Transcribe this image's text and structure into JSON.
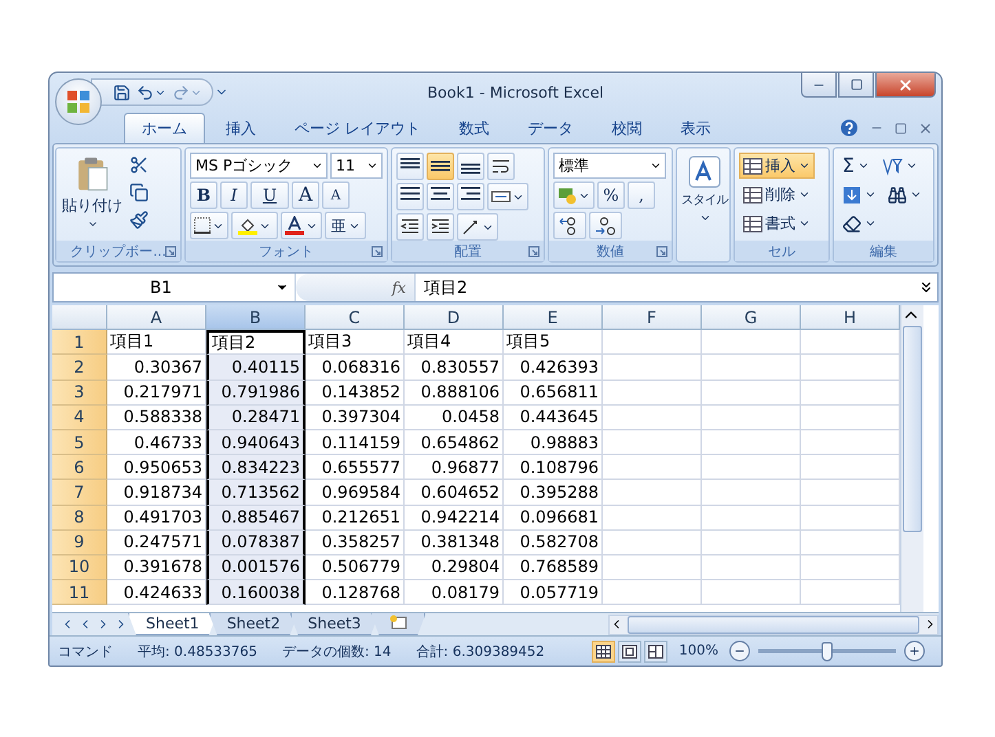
{
  "window": {
    "title": "Book1 - Microsoft Excel"
  },
  "tabs": [
    {
      "label": "ホーム",
      "selected": true
    },
    {
      "label": "挿入",
      "selected": false
    },
    {
      "label": "ページ レイアウト",
      "selected": false
    },
    {
      "label": "数式",
      "selected": false
    },
    {
      "label": "データ",
      "selected": false
    },
    {
      "label": "校閲",
      "selected": false
    },
    {
      "label": "表示",
      "selected": false
    }
  ],
  "ribbon": {
    "clipboard": {
      "label": "クリップボー...",
      "paste": "貼り付け"
    },
    "font": {
      "label": "フォント",
      "name": "MS Pゴシック",
      "size": "11",
      "bold": "B",
      "italic": "I",
      "underline": "U",
      "grow": "A",
      "shrink": "A",
      "phonetic": "亜"
    },
    "alignment": {
      "label": "配置",
      "buttons": [
        {
          "kind": "top",
          "selected": false
        },
        {
          "kind": "middle",
          "selected": true
        },
        {
          "kind": "bottom",
          "selected": false
        }
      ]
    },
    "number": {
      "label": "数値",
      "format": "標準",
      "percent": "%",
      "comma": ","
    },
    "styles": {
      "label": "スタイル"
    },
    "cells": {
      "label": "セル",
      "buttons": [
        {
          "label": "挿入",
          "highlighted": true
        },
        {
          "label": "削除",
          "highlighted": false
        },
        {
          "label": "書式",
          "highlighted": false
        }
      ]
    },
    "editing": {
      "label": "編集",
      "sum": "Σ"
    }
  },
  "formula_bar": {
    "name_box": "B1",
    "function_label": "fx",
    "value": "項目2"
  },
  "sheet": {
    "columns": [
      {
        "label": "A",
        "selected": false
      },
      {
        "label": "B",
        "selected": true
      },
      {
        "label": "C",
        "selected": false
      },
      {
        "label": "D",
        "selected": false
      },
      {
        "label": "E",
        "selected": false
      },
      {
        "label": "F",
        "selected": false
      },
      {
        "label": "G",
        "selected": false
      },
      {
        "label": "H",
        "selected": false
      }
    ],
    "rows": [
      {
        "number": "1",
        "kind": "text",
        "cells": [
          "項目1",
          "項目2",
          "項目3",
          "項目4",
          "項目5"
        ]
      },
      {
        "number": "2",
        "kind": "number",
        "cells": [
          "0.30367",
          "0.40115",
          "0.068316",
          "0.830557",
          "0.426393"
        ]
      },
      {
        "number": "3",
        "kind": "number",
        "cells": [
          "0.217971",
          "0.791986",
          "0.143852",
          "0.888106",
          "0.656811"
        ]
      },
      {
        "number": "4",
        "kind": "number",
        "cells": [
          "0.588338",
          "0.28471",
          "0.397304",
          "0.0458",
          "0.443645"
        ]
      },
      {
        "number": "5",
        "kind": "number",
        "cells": [
          "0.46733",
          "0.940643",
          "0.114159",
          "0.654862",
          "0.98883"
        ]
      },
      {
        "number": "6",
        "kind": "number",
        "cells": [
          "0.950653",
          "0.834223",
          "0.655577",
          "0.96877",
          "0.108796"
        ]
      },
      {
        "number": "7",
        "kind": "number",
        "cells": [
          "0.918734",
          "0.713562",
          "0.969584",
          "0.604652",
          "0.395288"
        ]
      },
      {
        "number": "8",
        "kind": "number",
        "cells": [
          "0.491703",
          "0.885467",
          "0.212651",
          "0.942214",
          "0.096681"
        ]
      },
      {
        "number": "9",
        "kind": "number",
        "cells": [
          "0.247571",
          "0.078387",
          "0.358257",
          "0.381348",
          "0.582708"
        ]
      },
      {
        "number": "10",
        "kind": "number",
        "cells": [
          "0.391678",
          "0.001576",
          "0.506779",
          "0.29804",
          "0.768589"
        ]
      },
      {
        "number": "11",
        "kind": "number",
        "cells": [
          "0.424633",
          "0.160038",
          "0.128768",
          "0.08179",
          "0.057719"
        ]
      }
    ]
  },
  "sheet_tabs": [
    {
      "label": "Sheet1",
      "selected": true
    },
    {
      "label": "Sheet2",
      "selected": false
    },
    {
      "label": "Sheet3",
      "selected": false
    }
  ],
  "status_bar": {
    "mode": "コマンド",
    "average": "平均: 0.48533765",
    "count": "データの個数: 14",
    "sum": "合計: 6.309389452",
    "views": [
      {
        "kind": "normal",
        "selected": true
      },
      {
        "kind": "layout",
        "selected": false
      },
      {
        "kind": "pagebreak",
        "selected": false
      }
    ],
    "zoom": "100%",
    "zoom_slider": {
      "level": 0.5
    }
  }
}
